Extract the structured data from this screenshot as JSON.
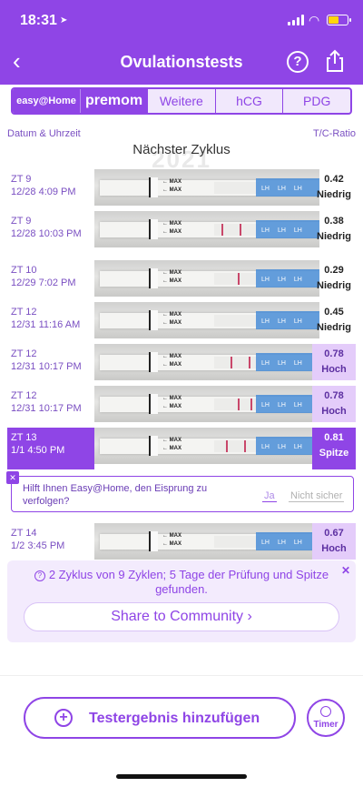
{
  "status_bar": {
    "time": "18:31"
  },
  "header": {
    "title": "Ovulationstests"
  },
  "brand_tabs": {
    "easy": "easy@Home",
    "premom": "premom",
    "weitere": "Weitere",
    "hcg": "hCG",
    "pdg": "PDG"
  },
  "columns": {
    "left": "Datum & Uhrzeit",
    "right": "T/C-Ratio"
  },
  "cycle": {
    "label": "Nächster Zyklus",
    "year": "2021"
  },
  "strip_text": {
    "max": "MAX",
    "lh": "LH"
  },
  "rows": [
    {
      "day": "ZT 9",
      "datetime": "12/28 4:09 PM",
      "ratio": "0.42",
      "level": "Niedrig"
    },
    {
      "day": "ZT 9",
      "datetime": "12/28 10:03 PM",
      "ratio": "0.38",
      "level": "Niedrig"
    },
    {
      "day": "ZT 10",
      "datetime": "12/29 7:02 PM",
      "ratio": "0.29",
      "level": "Niedrig"
    },
    {
      "day": "ZT 12",
      "datetime": "12/31 11:16 AM",
      "ratio": "0.45",
      "level": "Niedrig"
    },
    {
      "day": "ZT 12",
      "datetime": "12/31 10:17 PM",
      "ratio": "0.78",
      "level": "Hoch"
    },
    {
      "day": "ZT 12",
      "datetime": "12/31 10:17 PM",
      "ratio": "0.78",
      "level": "Hoch"
    },
    {
      "day": "ZT 13",
      "datetime": "1/1 4:50 PM",
      "ratio": "0.81",
      "level": "Spitze"
    },
    {
      "day": "ZT 14",
      "datetime": "1/2 3:45 PM",
      "ratio": "0.67",
      "level": "Hoch"
    }
  ],
  "question": {
    "text": "Hilft Ihnen Easy@Home, den Eisprung zu verfolgen?",
    "yes": "Ja",
    "unsure": "Nicht sicher"
  },
  "summary": {
    "text": "2 Zyklus von 9 Zyklen; 5 Tage der Prüfung und Spitze gefunden.",
    "community": "Share to Community ›"
  },
  "actions": {
    "add_result": "Testergebnis hinzufügen",
    "timer": "Timer"
  },
  "colors": {
    "brand_purple": "#8f45e6",
    "hoch_bg": "#e4ccfa",
    "peak_bg": "#8f45e6"
  }
}
